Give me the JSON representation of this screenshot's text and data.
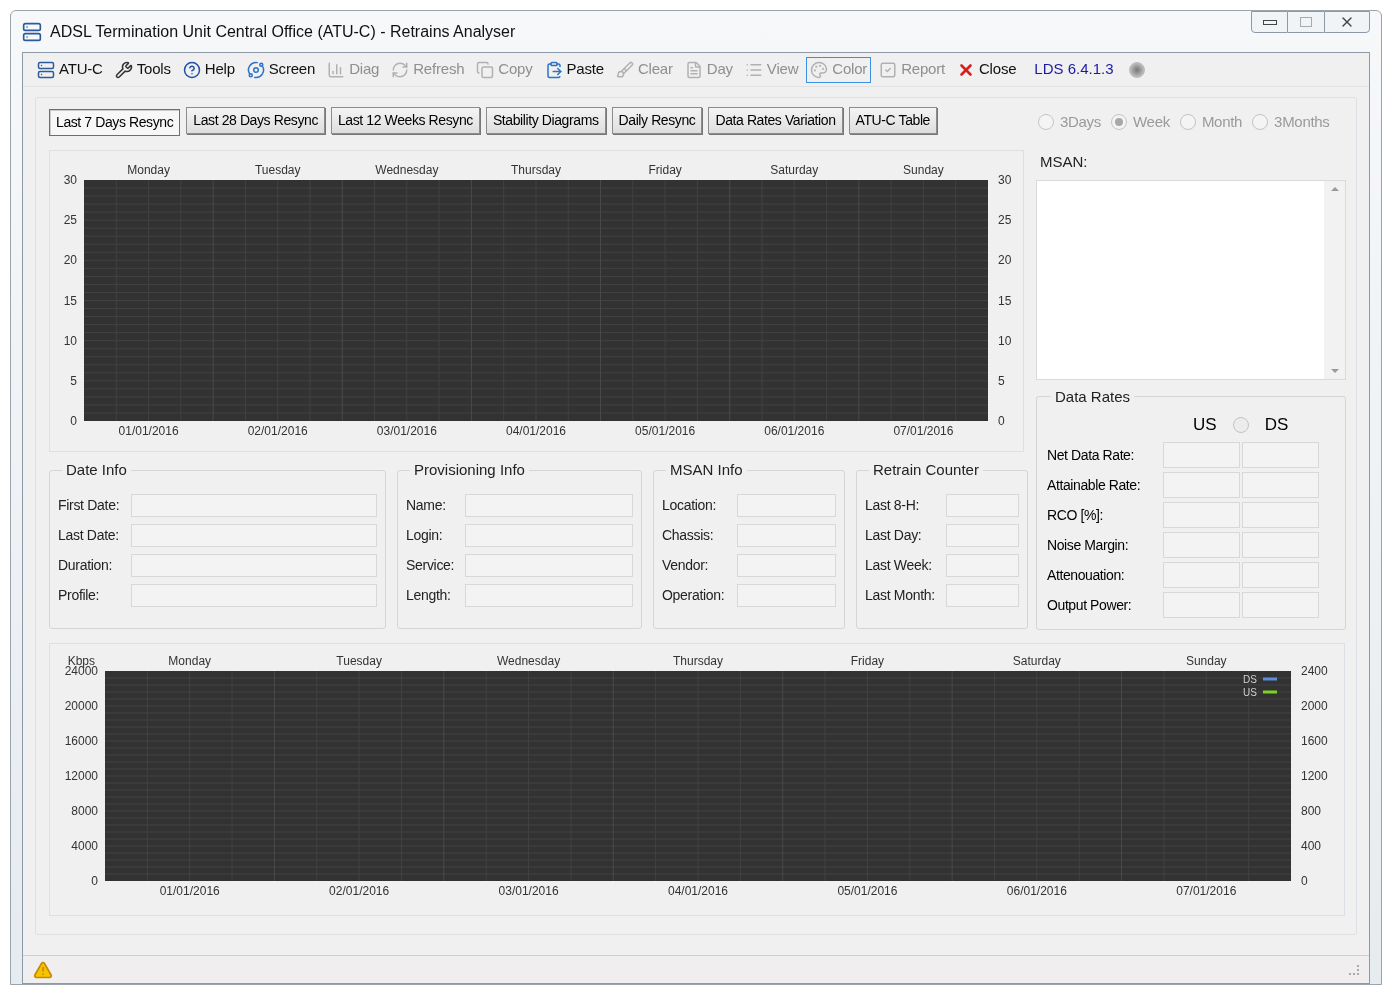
{
  "window": {
    "title": "ADSL Termination Unit Central Office (ATU-C) - Retrains Analyser"
  },
  "toolbar": {
    "items": [
      {
        "label": "ATU-C",
        "disabled": false,
        "focused": false
      },
      {
        "label": "Tools",
        "disabled": false,
        "focused": false
      },
      {
        "label": "Help",
        "disabled": false,
        "focused": false
      },
      {
        "label": "Screen",
        "disabled": false,
        "focused": false
      },
      {
        "label": "Diag",
        "disabled": true,
        "focused": false
      },
      {
        "label": "Refresh",
        "disabled": true,
        "focused": false
      },
      {
        "label": "Copy",
        "disabled": true,
        "focused": false
      },
      {
        "label": "Paste",
        "disabled": false,
        "focused": false
      },
      {
        "label": "Clear",
        "disabled": true,
        "focused": false
      },
      {
        "label": "Day",
        "disabled": true,
        "focused": false
      },
      {
        "label": "View",
        "disabled": true,
        "focused": false
      },
      {
        "label": "Color",
        "disabled": true,
        "focused": true
      },
      {
        "label": "Report",
        "disabled": true,
        "focused": false
      },
      {
        "label": "Close",
        "disabled": false,
        "focused": false
      }
    ],
    "version": "LDS 6.4.1.3"
  },
  "tabs": [
    {
      "label": "Last 7 Days Resync",
      "selected": true
    },
    {
      "label": "Last 28 Days Resync",
      "selected": false
    },
    {
      "label": "Last 12 Weeks Resync",
      "selected": false
    },
    {
      "label": "Stability Diagrams",
      "selected": false
    },
    {
      "label": "Daily Resync",
      "selected": false
    },
    {
      "label": "Data Rates Variation",
      "selected": false
    },
    {
      "label": "ATU-C Table",
      "selected": false
    }
  ],
  "period": {
    "enabled": false,
    "options": [
      {
        "label": "3Days",
        "selected": false
      },
      {
        "label": "Week",
        "selected": true
      },
      {
        "label": "Month",
        "selected": false
      },
      {
        "label": "3Months",
        "selected": false
      }
    ]
  },
  "resync_chart": {
    "day_labels": [
      "Monday",
      "Tuesday",
      "Wednesday",
      "Thursday",
      "Friday",
      "Saturday",
      "Sunday"
    ],
    "y2ticks": [
      "30",
      "25",
      "20",
      "15",
      "10",
      "5",
      "0"
    ],
    "chart_data": {
      "type": "line",
      "grid": true,
      "categories": [
        "01/01/2016",
        "02/01/2016",
        "03/01/2016",
        "04/01/2016",
        "05/01/2016",
        "06/01/2016",
        "07/01/2016"
      ],
      "ylim": [
        0,
        30
      ],
      "yticks": [
        0,
        5,
        10,
        15,
        20,
        25,
        30
      ],
      "values": [
        null,
        null,
        null,
        null,
        null,
        null,
        null
      ]
    }
  },
  "msan_list": {
    "label": "MSAN:"
  },
  "groups": [
    {
      "title": "Date Info",
      "fields": [
        "First Date:",
        "Last Date:",
        "Duration:",
        "Profile:"
      ]
    },
    {
      "title": "Provisioning Info",
      "fields": [
        "Name:",
        "Login:",
        "Service:",
        "Length:"
      ]
    },
    {
      "title": "MSAN Info",
      "fields": [
        "Location:",
        "Chassis:",
        "Vendor:",
        "Operation:"
      ]
    },
    {
      "title": "Retrain Counter",
      "fields": [
        "Last 8-H:",
        "Last Day:",
        "Last Week:",
        "Last Month:"
      ]
    }
  ],
  "data_rates": {
    "title": "Data Rates",
    "us_label": "US",
    "ds_label": "DS",
    "toggle_selected": false,
    "rows": [
      "Net Data Rate:",
      "Attainable Rate:",
      "RCO [%]:",
      "Noise Margin:",
      "Attenouation:",
      "Output Power:"
    ]
  },
  "rate_chart": {
    "unit": "Kbps",
    "day_labels": [
      "Monday",
      "Tuesday",
      "Wednesday",
      "Thursday",
      "Friday",
      "Saturday",
      "Sunday"
    ],
    "y2ticks": [
      "2400",
      "2000",
      "1600",
      "1200",
      "800",
      "400",
      "0"
    ],
    "chart_data": {
      "type": "line",
      "grid": true,
      "categories": [
        "01/01/2016",
        "02/01/2016",
        "03/01/2016",
        "04/01/2016",
        "05/01/2016",
        "06/01/2016",
        "07/01/2016"
      ],
      "ylim": [
        0,
        24000
      ],
      "yticks": [
        0,
        4000,
        8000,
        12000,
        16000,
        20000,
        24000
      ],
      "series": [
        {
          "name": "DS",
          "color": "#5b8fd8",
          "values": [
            null,
            null,
            null,
            null,
            null,
            null,
            null
          ]
        },
        {
          "name": "US",
          "color": "#7ed321",
          "values": [
            null,
            null,
            null,
            null,
            null,
            null,
            null
          ]
        }
      ]
    }
  }
}
